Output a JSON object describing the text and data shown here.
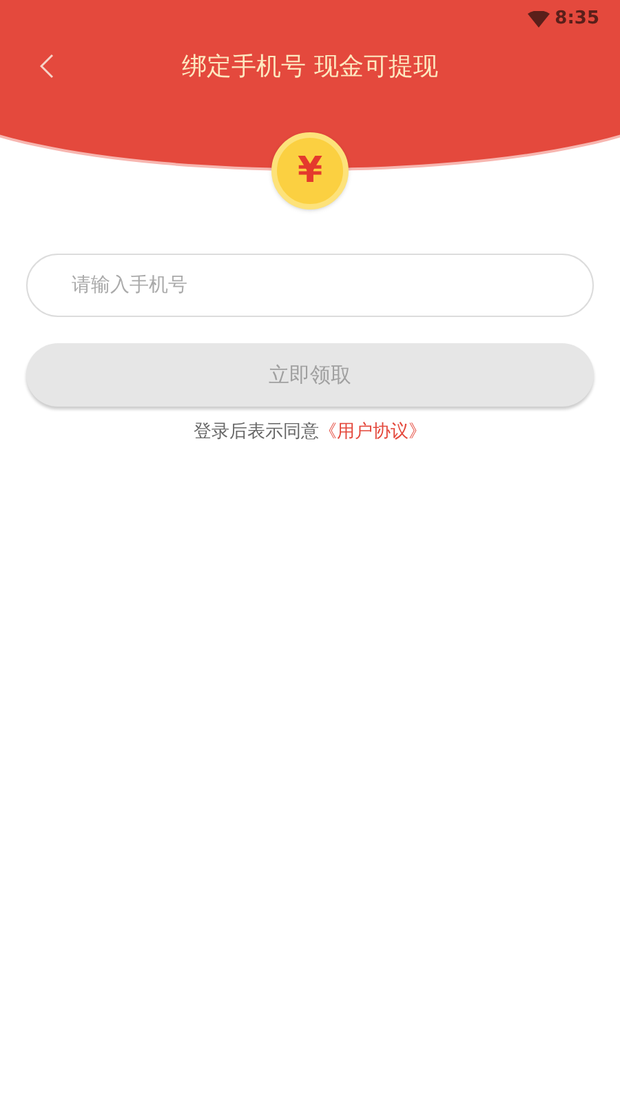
{
  "status_bar": {
    "time": "8:35"
  },
  "header": {
    "title": "绑定手机号 现金可提现"
  },
  "coin": {
    "symbol": "¥"
  },
  "phone_field": {
    "placeholder": "请输入手机号"
  },
  "claim_button": {
    "label": "立即领取",
    "disabled": true
  },
  "agreement": {
    "text": "登录后表示同意",
    "link": "《用户协议》"
  }
}
